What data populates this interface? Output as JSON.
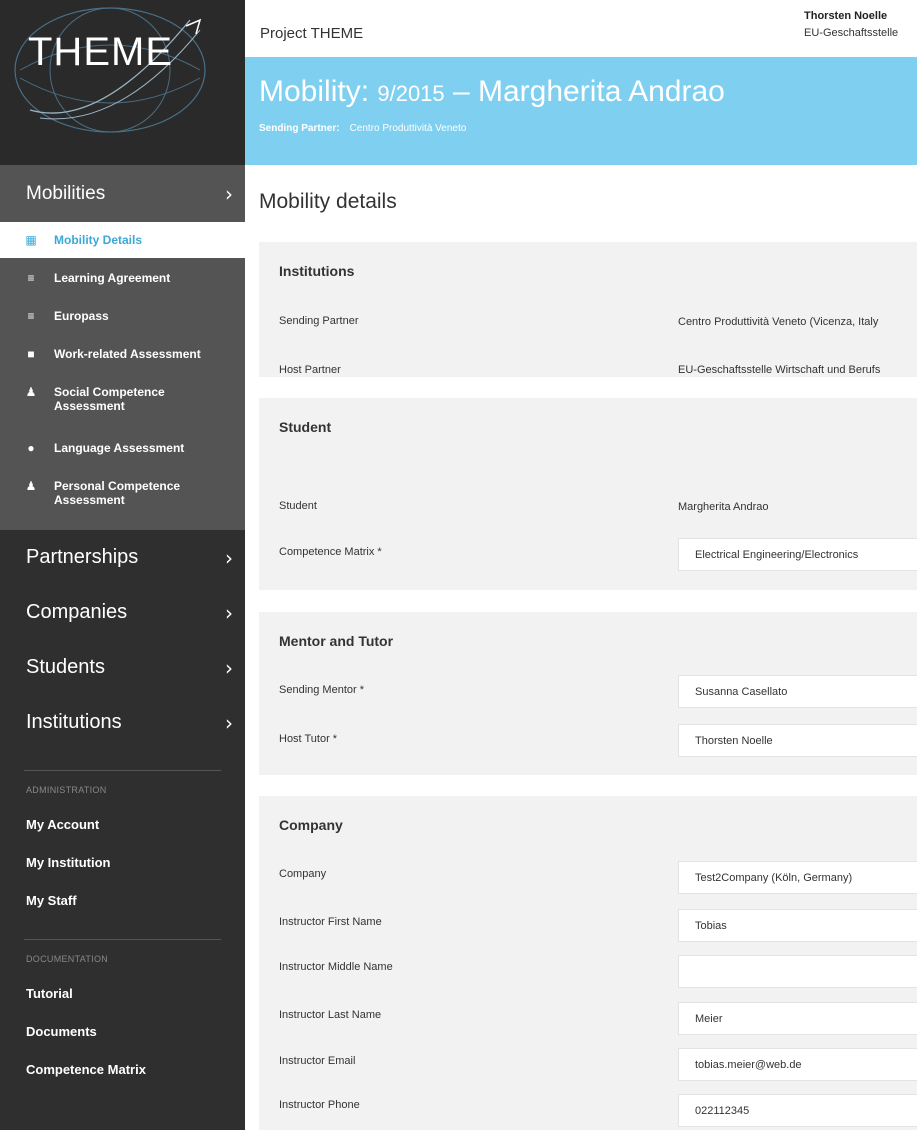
{
  "logo": {
    "text": "THEME"
  },
  "sidebar": {
    "mobilities_label": "Mobilities",
    "active_item": {
      "icon": "bank-icon",
      "label": "Mobility Details"
    },
    "sub_items": [
      {
        "icon": "list-icon",
        "label": "Learning Agreement"
      },
      {
        "icon": "list-icon",
        "label": "Europass"
      },
      {
        "icon": "briefcase-icon",
        "label": "Work-related Assessment"
      },
      {
        "icon": "people-icon",
        "label": "Social Competence Assessment"
      },
      {
        "icon": "globe-icon",
        "label": "Language Assessment"
      },
      {
        "icon": "person-icon",
        "label": "Personal Competence Assessment"
      }
    ],
    "main_nav": [
      "Partnerships",
      "Companies",
      "Students",
      "Institutions"
    ],
    "admin_label": "ADMINISTRATION",
    "admin_links": [
      "My Account",
      "My Institution",
      "My Staff"
    ],
    "docs_label": "DOCUMENTATION",
    "docs_links": [
      "Tutorial",
      "Documents",
      "Competence Matrix"
    ]
  },
  "header": {
    "project": "Project THEME",
    "user_name": "Thorsten Noelle",
    "user_org": "EU-Geschaftsstelle"
  },
  "banner": {
    "title_prefix": "Mobility: ",
    "title_number": "9/2015",
    "title_suffix": " – Margherita Andrao",
    "sending_partner_label": "Sending Partner:",
    "sending_partner_value": "Centro Produttività Veneto",
    "color": "#7fd0f0"
  },
  "page_title": "Mobility details",
  "institutions": {
    "title": "Institutions",
    "sending_partner_label": "Sending Partner",
    "sending_partner_value": "Centro Produttività Veneto (Vicenza, Italy",
    "host_partner_label": "Host Partner",
    "host_partner_value": "EU-Geschaftsstelle Wirtschaft und Berufs"
  },
  "student": {
    "title": "Student",
    "student_label": "Student",
    "student_value": "Margherita Andrao",
    "matrix_label": "Competence Matrix *",
    "matrix_value": "Electrical Engineering/Electronics"
  },
  "mentor": {
    "title": "Mentor and Tutor",
    "sending_mentor_label": "Sending Mentor *",
    "sending_mentor_value": "Susanna Casellato",
    "host_tutor_label": "Host Tutor *",
    "host_tutor_value": "Thorsten Noelle"
  },
  "company": {
    "title": "Company",
    "company_label": "Company",
    "company_value": "Test2Company (Köln, Germany)",
    "first_name_label": "Instructor First Name",
    "first_name_value": "Tobias",
    "middle_name_label": "Instructor Middle Name",
    "middle_name_value": "",
    "last_name_label": "Instructor Last Name",
    "last_name_value": "Meier",
    "email_label": "Instructor Email",
    "email_value": "tobias.meier@web.de",
    "phone_label": "Instructor Phone",
    "phone_value": "022112345"
  }
}
